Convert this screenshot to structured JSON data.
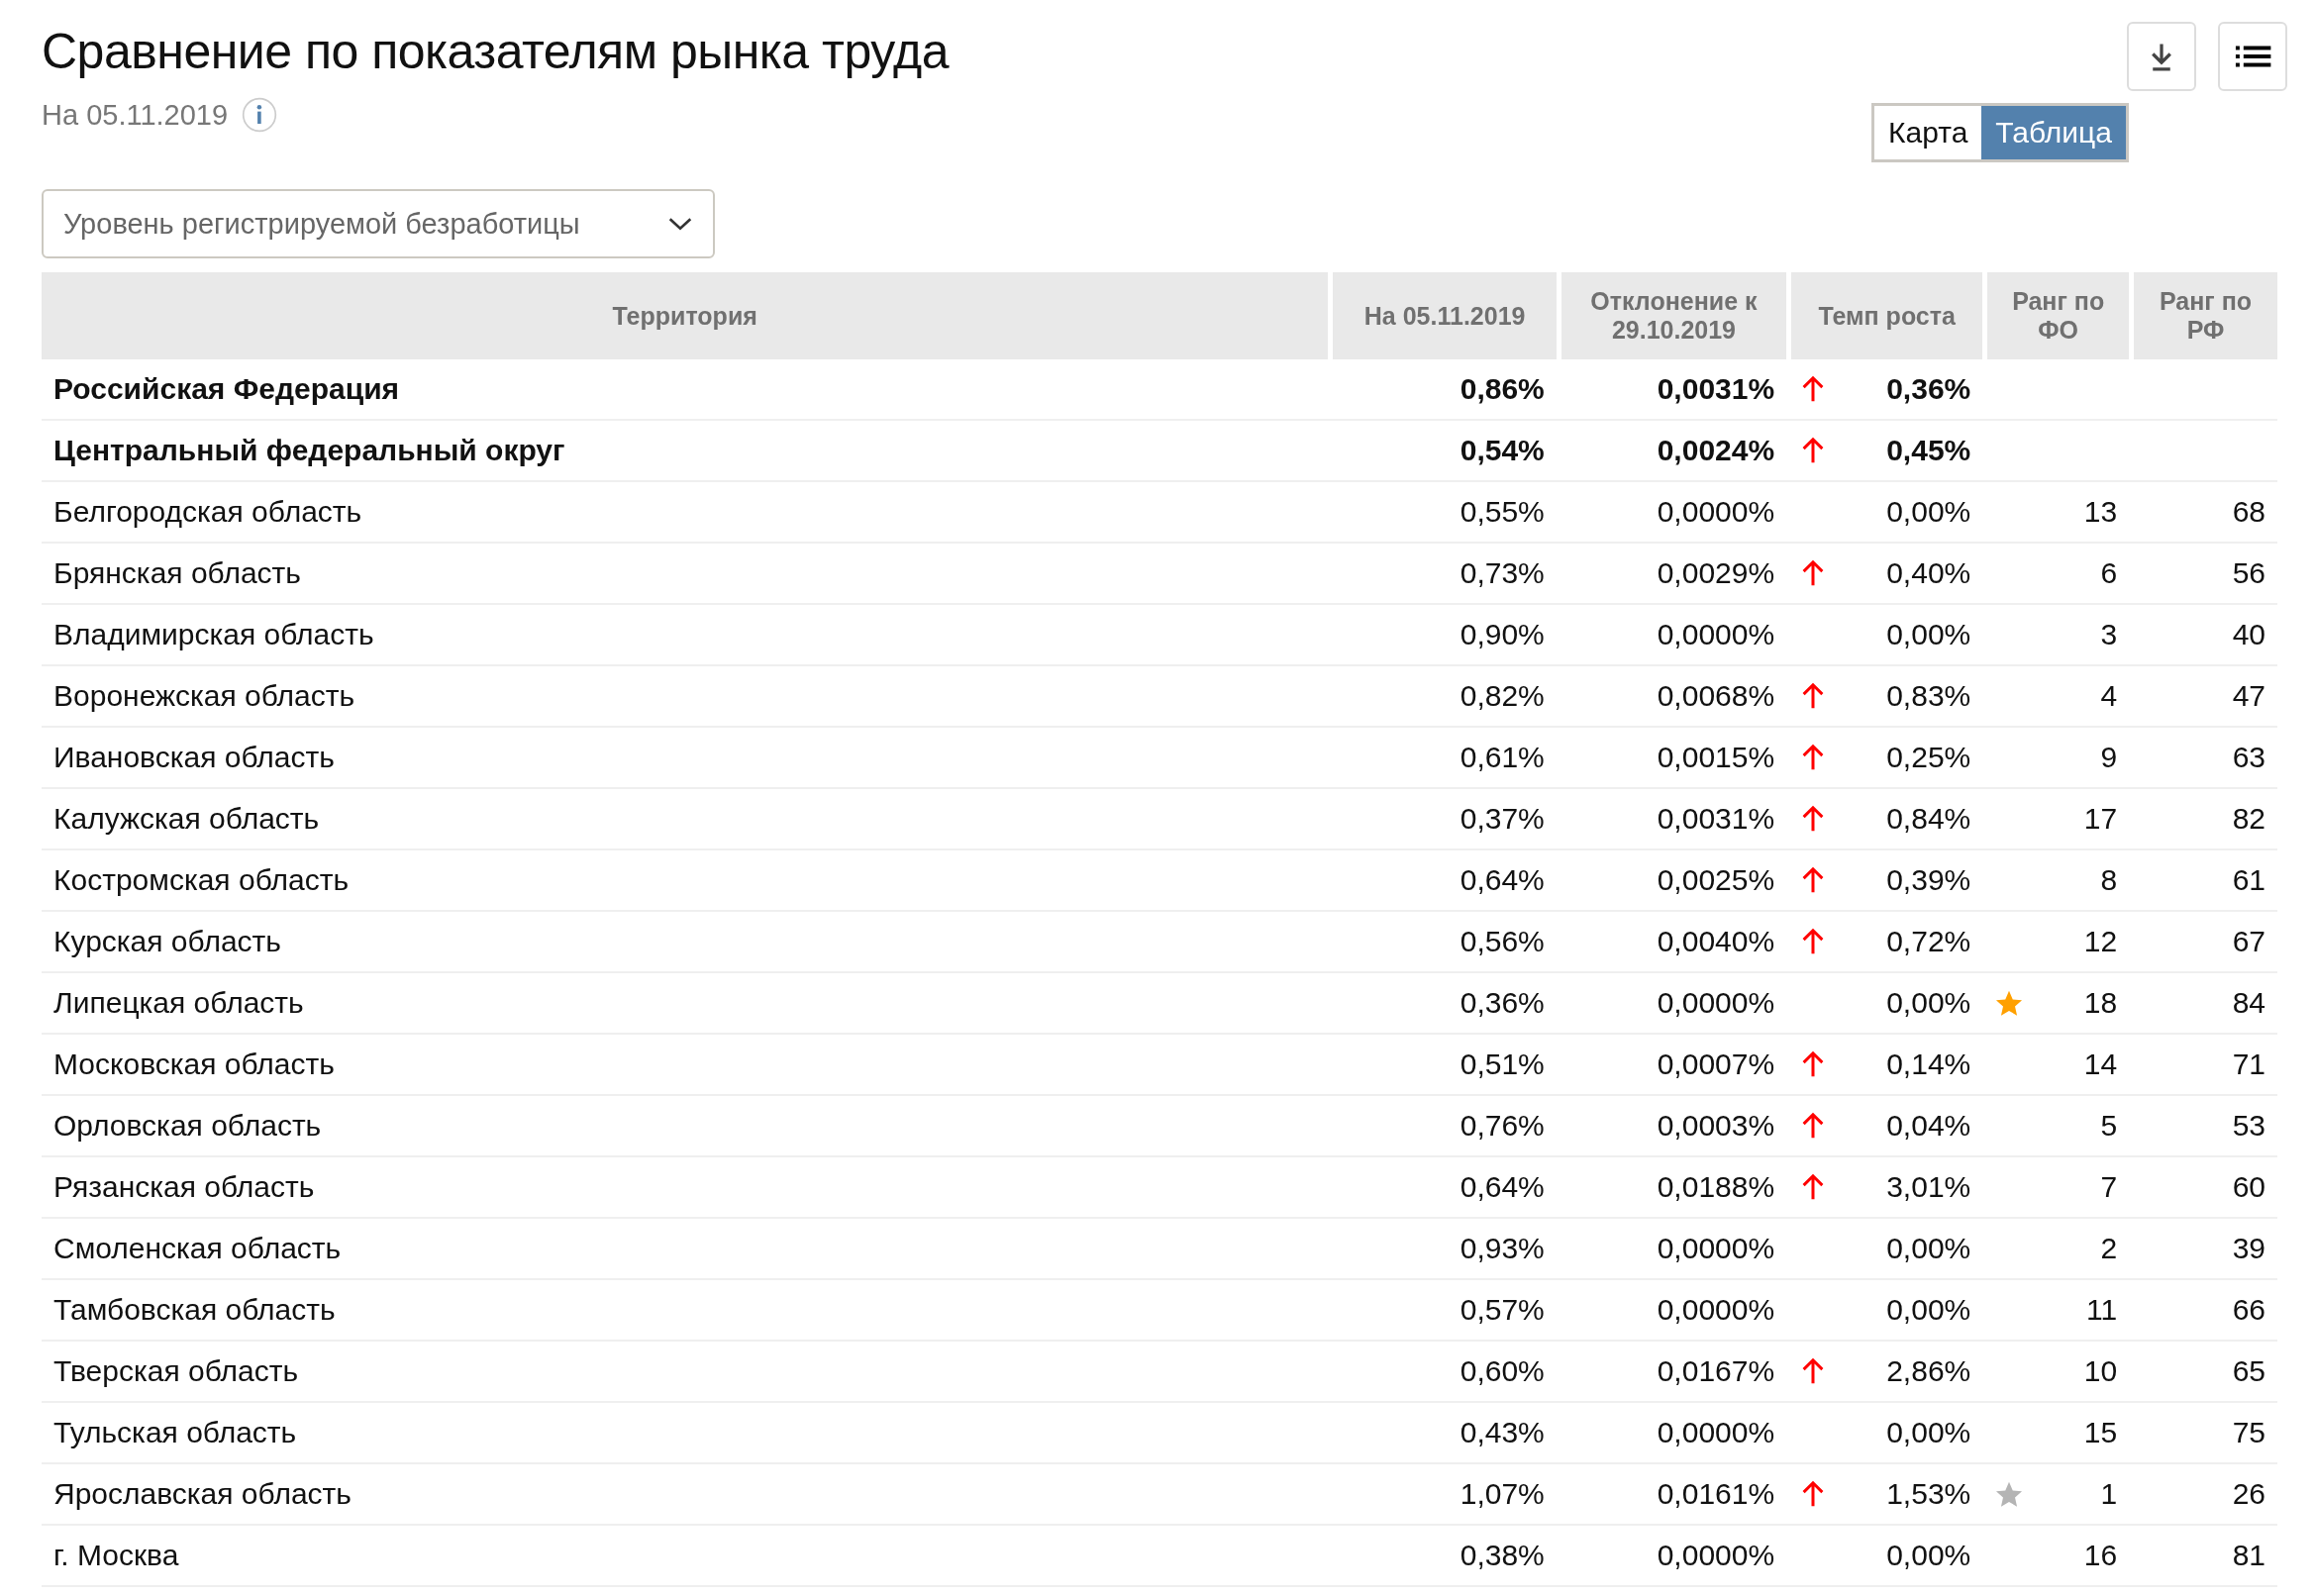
{
  "title": "Сравнение по показателям рынка труда",
  "subtitle": "На 05.11.2019",
  "view_tabs": [
    {
      "label": "Карта",
      "selected": false
    },
    {
      "label": "Таблица",
      "selected": true
    }
  ],
  "indicator_dropdown": {
    "value": "Уровень регистрируемой безработицы"
  },
  "table": {
    "columns": [
      "Территория",
      "На 05.11.2019",
      "Отклонение к 29.10.2019",
      "Темп роста",
      "Ранг по ФО",
      "Ранг по РФ"
    ],
    "rows": [
      {
        "kind": "total",
        "territory": "Российская Федерация",
        "value": "0,86%",
        "deviation": "0,0031%",
        "rising": true,
        "growth": "0,36%"
      },
      {
        "kind": "total",
        "territory": "Центральный федеральный округ",
        "value": "0,54%",
        "deviation": "0,0024%",
        "rising": true,
        "growth": "0,45%"
      },
      {
        "kind": "region",
        "territory": "Белгородская область",
        "value": "0,55%",
        "deviation": "0,0000%",
        "rising": false,
        "growth": "0,00%",
        "rank_fo": "13",
        "rank_rf": "68"
      },
      {
        "kind": "region",
        "territory": "Брянская область",
        "value": "0,73%",
        "deviation": "0,0029%",
        "rising": true,
        "growth": "0,40%",
        "rank_fo": "6",
        "rank_rf": "56"
      },
      {
        "kind": "region",
        "territory": "Владимирская область",
        "value": "0,90%",
        "deviation": "0,0000%",
        "rising": false,
        "growth": "0,00%",
        "rank_fo": "3",
        "rank_rf": "40"
      },
      {
        "kind": "region",
        "territory": "Воронежская область",
        "value": "0,82%",
        "deviation": "0,0068%",
        "rising": true,
        "growth": "0,83%",
        "rank_fo": "4",
        "rank_rf": "47"
      },
      {
        "kind": "region",
        "territory": "Ивановская область",
        "value": "0,61%",
        "deviation": "0,0015%",
        "rising": true,
        "growth": "0,25%",
        "rank_fo": "9",
        "rank_rf": "63"
      },
      {
        "kind": "region",
        "territory": "Калужская область",
        "value": "0,37%",
        "deviation": "0,0031%",
        "rising": true,
        "growth": "0,84%",
        "rank_fo": "17",
        "rank_rf": "82"
      },
      {
        "kind": "region",
        "territory": "Костромская область",
        "value": "0,64%",
        "deviation": "0,0025%",
        "rising": true,
        "growth": "0,39%",
        "rank_fo": "8",
        "rank_rf": "61"
      },
      {
        "kind": "region",
        "territory": "Курская область",
        "value": "0,56%",
        "deviation": "0,0040%",
        "rising": true,
        "growth": "0,72%",
        "rank_fo": "12",
        "rank_rf": "67"
      },
      {
        "kind": "region",
        "territory": "Липецкая область",
        "value": "0,36%",
        "deviation": "0,0000%",
        "rising": false,
        "growth": "0,00%",
        "color": "#ffa000",
        "rank_fo": "18",
        "rank_rf": "84"
      },
      {
        "kind": "region",
        "territory": "Московская область",
        "value": "0,51%",
        "deviation": "0,0007%",
        "rising": true,
        "growth": "0,14%",
        "rank_fo": "14",
        "rank_rf": "71"
      },
      {
        "kind": "region",
        "territory": "Орловская область",
        "value": "0,76%",
        "deviation": "0,0003%",
        "rising": true,
        "growth": "0,04%",
        "rank_fo": "5",
        "rank_rf": "53"
      },
      {
        "kind": "region",
        "territory": "Рязанская область",
        "value": "0,64%",
        "deviation": "0,0188%",
        "rising": true,
        "growth": "3,01%",
        "rank_fo": "7",
        "rank_rf": "60"
      },
      {
        "kind": "region",
        "territory": "Смоленская область",
        "value": "0,93%",
        "deviation": "0,0000%",
        "rising": false,
        "growth": "0,00%",
        "rank_fo": "2",
        "rank_rf": "39"
      },
      {
        "kind": "region",
        "territory": "Тамбовская область",
        "value": "0,57%",
        "deviation": "0,0000%",
        "rising": false,
        "growth": "0,00%",
        "rank_fo": "11",
        "rank_rf": "66"
      },
      {
        "kind": "region",
        "territory": "Тверская область",
        "value": "0,60%",
        "deviation": "0,0167%",
        "rising": true,
        "growth": "2,86%",
        "rank_fo": "10",
        "rank_rf": "65"
      },
      {
        "kind": "region",
        "territory": "Тульская область",
        "value": "0,43%",
        "deviation": "0,0000%",
        "rising": false,
        "growth": "0,00%",
        "rank_fo": "15",
        "rank_rf": "75"
      },
      {
        "kind": "region",
        "territory": "Ярославская область",
        "value": "1,07%",
        "deviation": "0,0161%",
        "rising": true,
        "growth": "1,53%",
        "color": "#b4b4b4",
        "rank_fo": "1",
        "rank_rf": "26"
      },
      {
        "kind": "region",
        "territory": "г. Москва",
        "value": "0,38%",
        "deviation": "0,0000%",
        "rising": false,
        "growth": "0,00%",
        "rank_fo": "16",
        "rank_rf": "81"
      }
    ]
  }
}
